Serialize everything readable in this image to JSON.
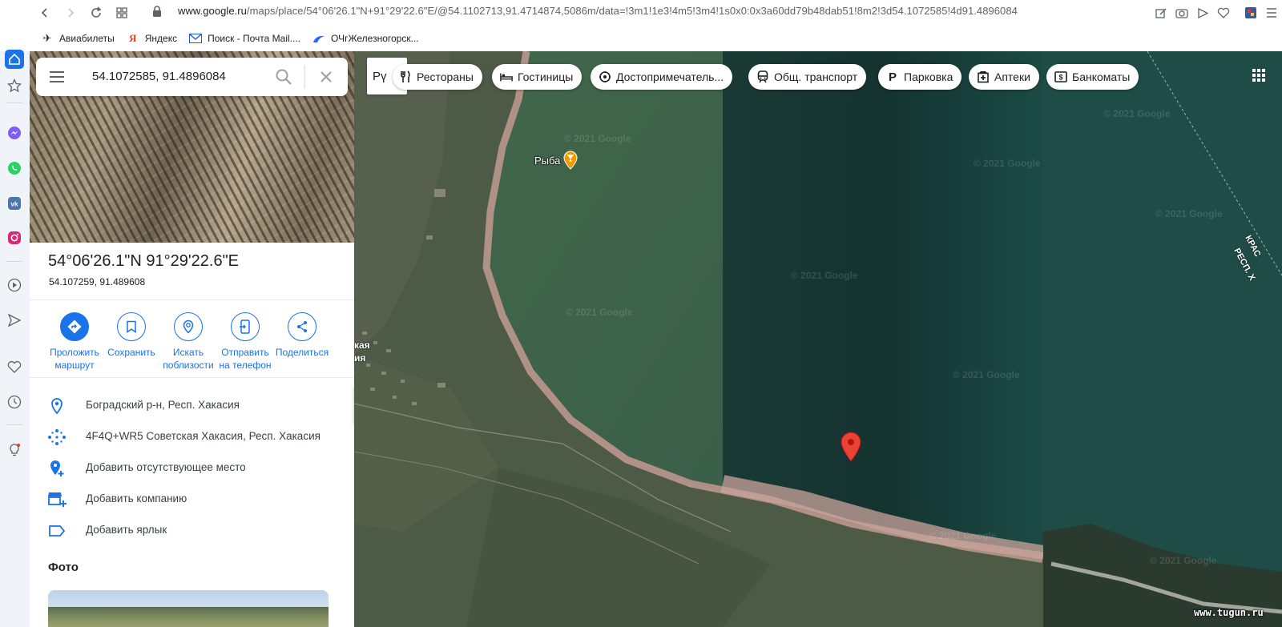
{
  "browser": {
    "url_host": "www.google.ru",
    "url_path": "/maps/place/54°06'26.1\"N+91°29'22.6\"E/@54.1102713,91.4714874,5086m/data=!3m1!1e3!4m5!3m4!1s0x0:0x3a60dd79b48dab51!8m2!3d54.1072585!4d91.4896084",
    "bookmarks": [
      {
        "icon": "airplane-icon",
        "label": "Авиабилеты"
      },
      {
        "icon": "yandex-icon",
        "label": "Яндекс"
      },
      {
        "icon": "mail-icon",
        "label": "Поиск - Почта Mail...."
      },
      {
        "icon": "weather-icon",
        "label": "ОЧгЖелезногорск..."
      }
    ]
  },
  "panel": {
    "search_query": "54.1072585, 91.4896084",
    "title": "54°06'26.1\"N 91°29'22.6\"E",
    "subtitle": "54.107259, 91.489608",
    "actions": [
      {
        "icon": "directions-icon",
        "label_1": "Проложить",
        "label_2": "маршрут"
      },
      {
        "icon": "bookmark-icon",
        "label_1": "Сохранить",
        "label_2": ""
      },
      {
        "icon": "nearby-icon",
        "label_1": "Искать",
        "label_2": "поблизости"
      },
      {
        "icon": "send-to-phone-icon",
        "label_1": "Отправить",
        "label_2": "на телефон"
      },
      {
        "icon": "share-icon",
        "label_1": "Поделиться",
        "label_2": ""
      }
    ],
    "info_rows": [
      {
        "icon": "location-pin-icon",
        "text": "Боградский р-н, Респ. Хакасия"
      },
      {
        "icon": "plus-code-icon",
        "text": "4F4Q+WR5 Советская Хакасия, Респ. Хакасия"
      },
      {
        "icon": "add-place-icon",
        "text": "Добавить отсутствующее место"
      },
      {
        "icon": "add-business-icon",
        "text": "Добавить компанию"
      },
      {
        "icon": "label-icon",
        "text": "Добавить ярлык"
      }
    ],
    "photos_heading": "Фото"
  },
  "map": {
    "layer_label": "Рү",
    "chips": [
      {
        "icon": "restaurant-icon",
        "label": "Рестораны"
      },
      {
        "icon": "hotel-icon",
        "label": "Гостиницы"
      },
      {
        "icon": "attraction-icon",
        "label": "Достопримечатель..."
      },
      {
        "icon": "transit-icon",
        "label": "Общ. транспорт"
      },
      {
        "icon": "parking-icon",
        "label": "Парковка"
      },
      {
        "icon": "pharmacy-icon",
        "label": "Аптеки"
      },
      {
        "icon": "atm-icon",
        "label": "Банкоматы"
      }
    ],
    "poi_label": "Рыба",
    "place_fragment_1": "кая",
    "place_fragment_2": "ия",
    "region_label_1": "КРАС",
    "region_label_2": "РЕСП. Х",
    "watermark": "© 2021 Google",
    "site_watermark": "www.tugun.ru",
    "colors": {
      "water": "#1f4a44",
      "shore": "#c9a39a",
      "land": "#4e5a44"
    }
  }
}
